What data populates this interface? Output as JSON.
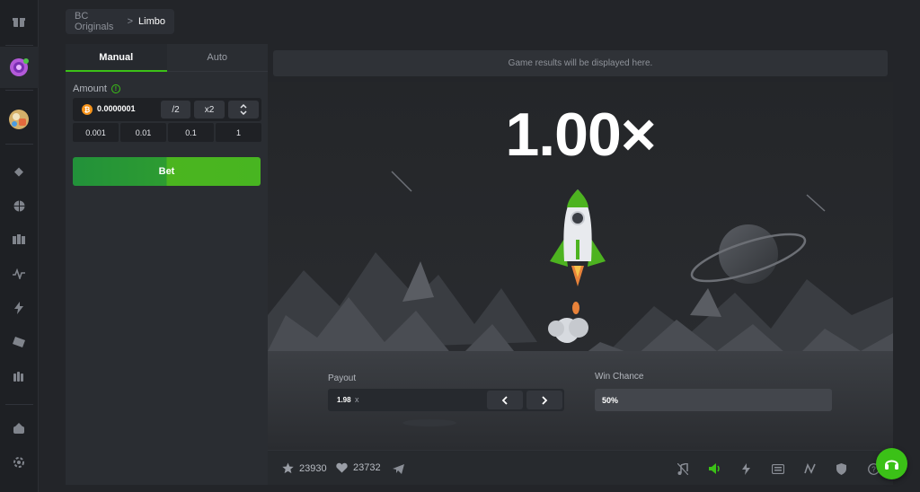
{
  "breadcrumb": {
    "parent": "BC Originals",
    "separator": ">",
    "current": "Limbo"
  },
  "tabs": [
    {
      "label": "Manual",
      "active": true
    },
    {
      "label": "Auto",
      "active": false
    }
  ],
  "amount": {
    "label": "Amount",
    "value": "0.0000001",
    "currency_icon": "bitcoin-icon",
    "half_label": "/2",
    "double_label": "x2",
    "quick_values": [
      "0.001",
      "0.01",
      "0.1",
      "1"
    ]
  },
  "bet": {
    "label": "Bet"
  },
  "game": {
    "results_placeholder": "Game results will be displayed here.",
    "multiplier": "1.00×"
  },
  "payout": {
    "label": "Payout",
    "value": "1.98",
    "suffix": "x"
  },
  "win_chance": {
    "label": "Win Chance",
    "value": "50%"
  },
  "footer": {
    "stars": "23930",
    "likes": "23732"
  },
  "colors": {
    "accent": "#3bc117",
    "background": "#232529",
    "panel": "#2a2d32"
  },
  "icons": {
    "rail": [
      "gift-icon",
      "spin-icon",
      "bonus-icon",
      "diamond-icon",
      "basketball-icon",
      "casino-icon",
      "pulse-icon",
      "lightning-icon",
      "ticket-icon",
      "hand-icon",
      "piggy-bank-icon",
      "settings-icon"
    ],
    "footer": [
      "music-icon",
      "volume-icon",
      "lightning-icon",
      "keyboard-icon",
      "chart-icon",
      "shield-icon",
      "help-icon"
    ]
  }
}
